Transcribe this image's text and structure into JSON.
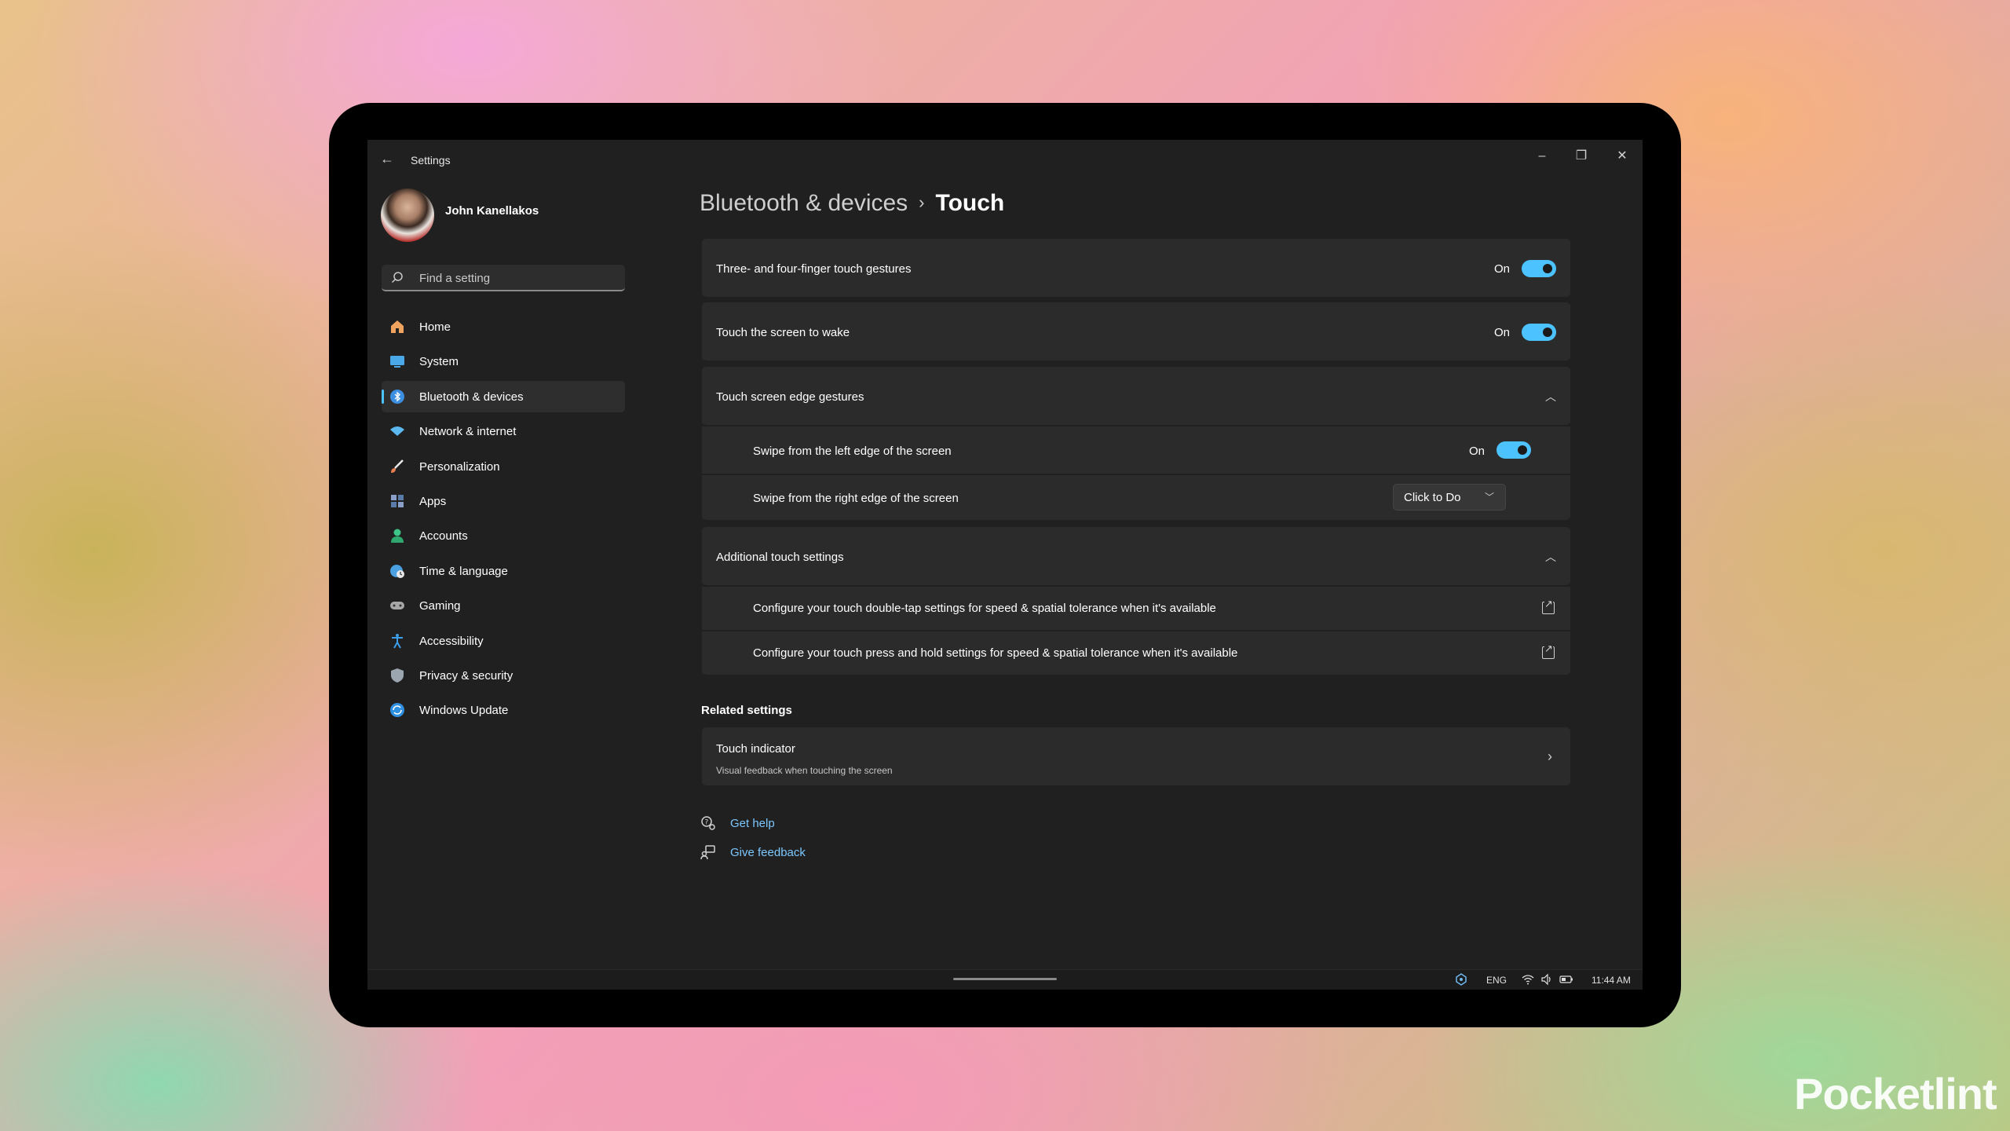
{
  "window": {
    "title": "Settings"
  },
  "profile": {
    "name": "John Kanellakos"
  },
  "search": {
    "placeholder": "Find a setting"
  },
  "sidebar": {
    "items": [
      {
        "label": "Home",
        "icon": "home-icon",
        "color": "#f0a35e"
      },
      {
        "label": "System",
        "icon": "system-icon",
        "color": "#4aa8e8"
      },
      {
        "label": "Bluetooth & devices",
        "icon": "bluetooth-icon",
        "color": "#3c8fe0",
        "active": true
      },
      {
        "label": "Network & internet",
        "icon": "wifi-icon",
        "color": "#5cb8f0"
      },
      {
        "label": "Personalization",
        "icon": "brush-icon",
        "color": "#e87f52"
      },
      {
        "label": "Apps",
        "icon": "apps-icon",
        "color": "#8aa0c8"
      },
      {
        "label": "Accounts",
        "icon": "person-icon",
        "color": "#3ec488"
      },
      {
        "label": "Time & language",
        "icon": "globe-clock-icon",
        "color": "#4aa0e0"
      },
      {
        "label": "Gaming",
        "icon": "gamepad-icon",
        "color": "#a8a8a8"
      },
      {
        "label": "Accessibility",
        "icon": "accessibility-icon",
        "color": "#3c9ee8"
      },
      {
        "label": "Privacy & security",
        "icon": "shield-icon",
        "color": "#9ba6b0"
      },
      {
        "label": "Windows Update",
        "icon": "update-icon",
        "color": "#2f8fe0"
      }
    ]
  },
  "breadcrumb": {
    "parent": "Bluetooth & devices",
    "separator": "›",
    "current": "Touch"
  },
  "settings": {
    "three_four_finger": {
      "label": "Three- and four-finger touch gestures",
      "state": "On"
    },
    "touch_wake": {
      "label": "Touch the screen to wake",
      "state": "On"
    },
    "edge_gestures": {
      "label": "Touch screen edge gestures",
      "left": {
        "label": "Swipe from the left edge of the screen",
        "state": "On"
      },
      "right": {
        "label": "Swipe from the right edge of the screen",
        "value": "Click to Do"
      }
    },
    "additional": {
      "label": "Additional touch settings",
      "double_tap": "Configure your touch double-tap settings for speed & spatial tolerance when it's available",
      "press_hold": "Configure your touch press and hold settings for speed & spatial tolerance when it's available"
    }
  },
  "related": {
    "title": "Related settings",
    "touch_indicator": {
      "title": "Touch indicator",
      "subtitle": "Visual feedback when touching the screen"
    }
  },
  "help": {
    "get_help": "Get help",
    "give_feedback": "Give feedback"
  },
  "taskbar": {
    "language": "ENG",
    "time": "11:44 AM"
  },
  "watermark": "Pocketlint",
  "colors": {
    "accent": "#4cc2ff",
    "link": "#7cc7ff",
    "background": "#202020",
    "card": "#2b2b2b"
  }
}
